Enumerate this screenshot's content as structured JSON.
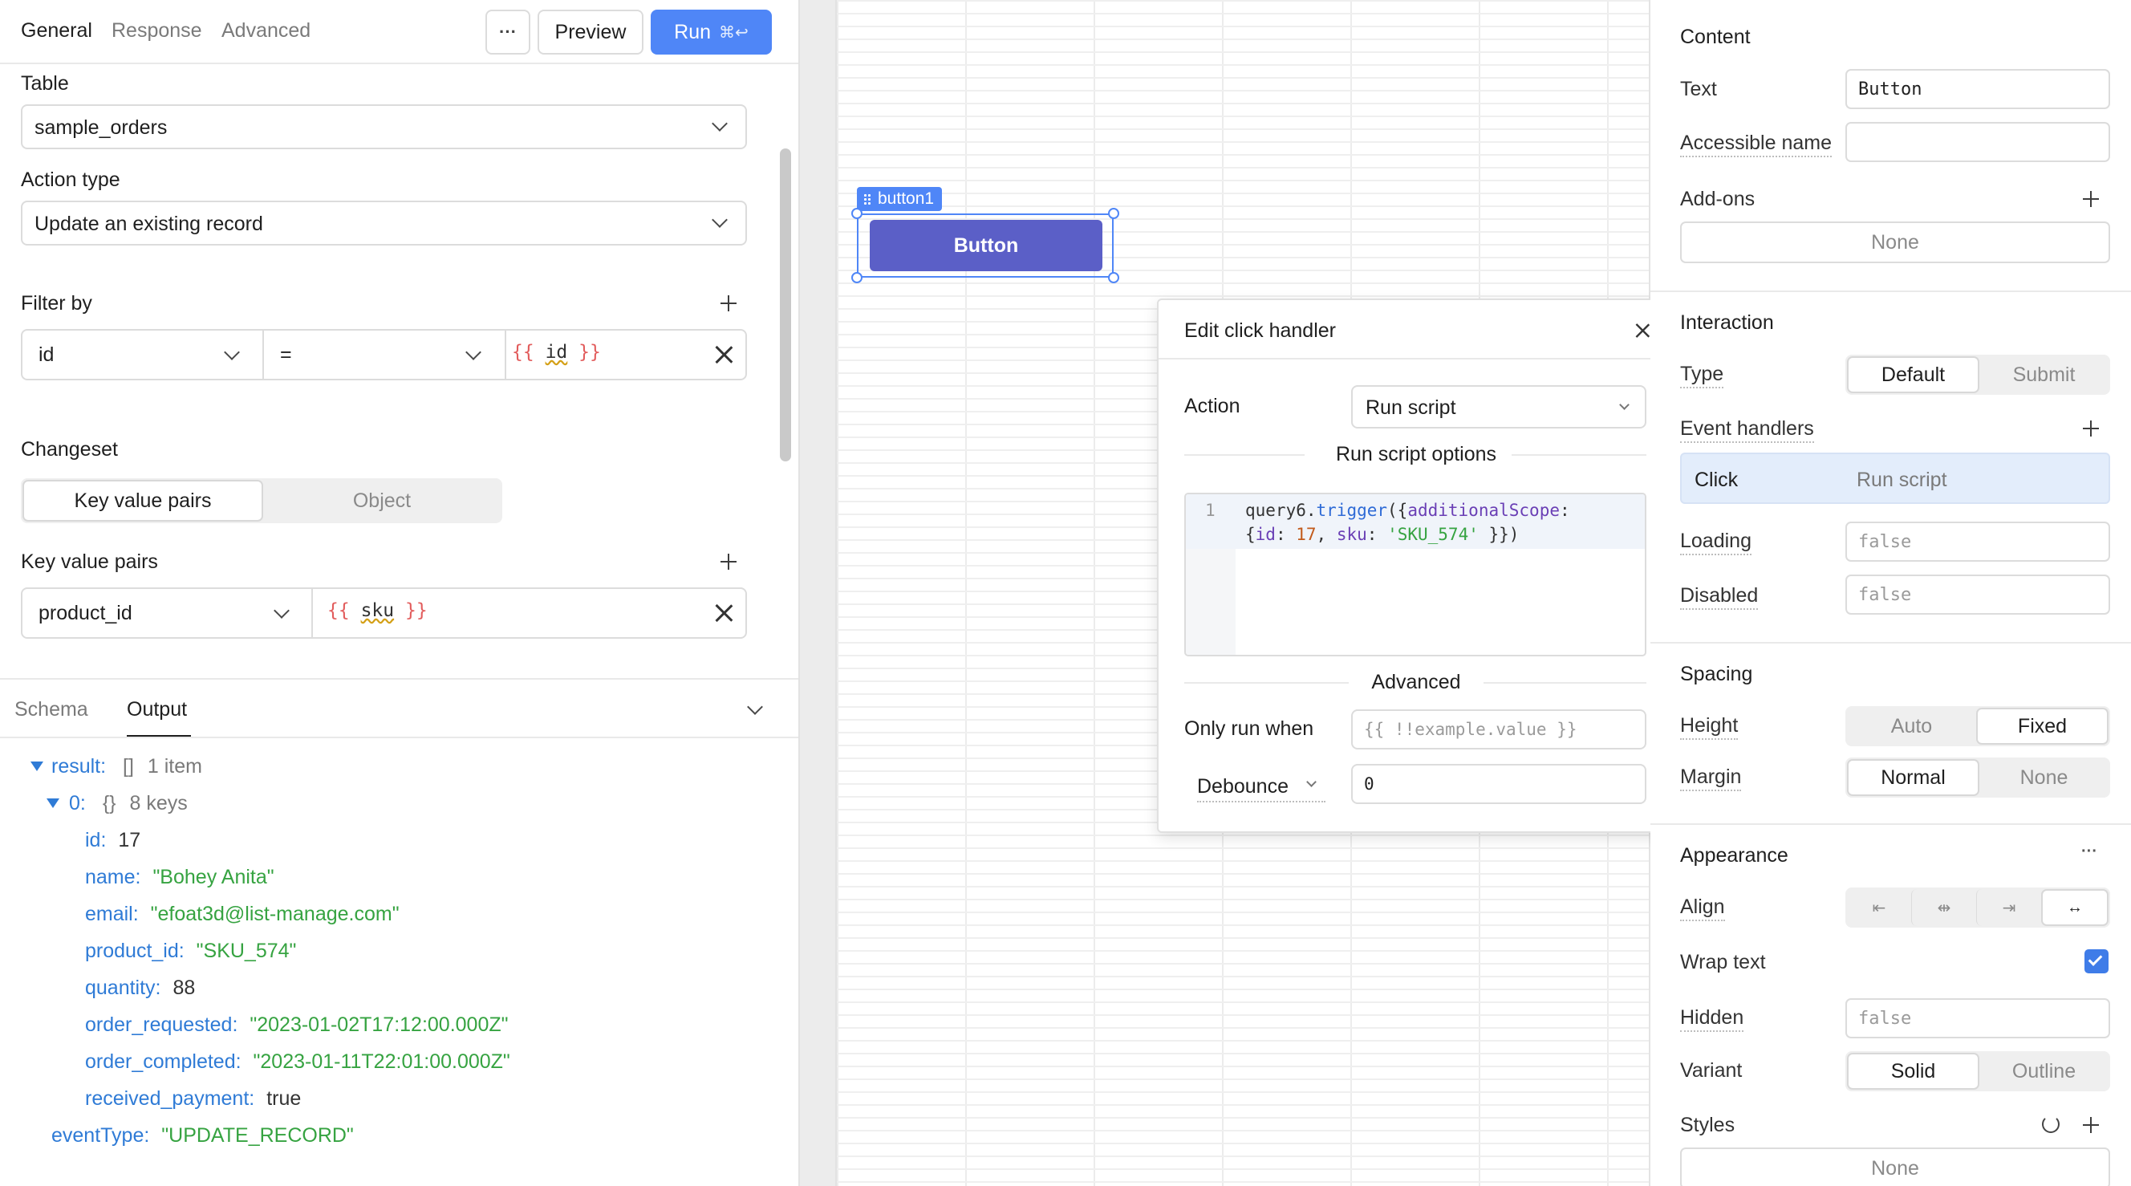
{
  "left_panel": {
    "tabs": [
      "General",
      "Response",
      "Advanced"
    ],
    "more_label": "···",
    "preview_label": "Preview",
    "run_label": "Run",
    "run_shortcut": "⌘↩",
    "table_label": "Table",
    "table_value": "sample_orders",
    "action_type_label": "Action type",
    "action_type_value": "Update an existing record",
    "filter_by_label": "Filter by",
    "filter": {
      "column": "id",
      "operator": "=",
      "value_open": "{{",
      "value_var": "id",
      "value_close": "}}"
    },
    "changeset_label": "Changeset",
    "changeset_options": [
      "Key value pairs",
      "Object"
    ],
    "kv_label": "Key value pairs",
    "kv_row": {
      "key": "product_id",
      "value_open": "{{",
      "value_var": "sku",
      "value_close": "}}"
    }
  },
  "output_panel": {
    "tabs": [
      "Schema",
      "Output"
    ],
    "result_key": "result:",
    "result_type": "[]",
    "result_count": "1 item",
    "item_key": "0:",
    "item_type": "{}",
    "item_count": "8 keys",
    "fields": [
      {
        "key": "id:",
        "value": "17",
        "kind": "num"
      },
      {
        "key": "name:",
        "value": "\"Bohey Anita\"",
        "kind": "str"
      },
      {
        "key": "email:",
        "value": "\"efoat3d@list-manage.com\"",
        "kind": "str"
      },
      {
        "key": "product_id:",
        "value": "\"SKU_574\"",
        "kind": "str"
      },
      {
        "key": "quantity:",
        "value": "88",
        "kind": "num"
      },
      {
        "key": "order_requested:",
        "value": "\"2023-01-02T17:12:00.000Z\"",
        "kind": "str"
      },
      {
        "key": "order_completed:",
        "value": "\"2023-01-11T22:01:00.000Z\"",
        "kind": "str"
      },
      {
        "key": "received_payment:",
        "value": "true",
        "kind": "num"
      }
    ],
    "event_key": "eventType:",
    "event_value": "\"UPDATE_RECORD\""
  },
  "canvas": {
    "component_tag": "button1",
    "button_label": "Button"
  },
  "click_handler": {
    "title": "Edit click handler",
    "action_label": "Action",
    "action_value": "Run script",
    "options_label": "Run script options",
    "line_number": "1",
    "code_line1": {
      "obj": "query6",
      "dot": ".",
      "fn": "trigger",
      "open": "({",
      "prop": "additionalScope",
      "colon": ":"
    },
    "code_line2": {
      "open": "{",
      "k1": "id",
      "c1": ": ",
      "v1": "17",
      "sep": ", ",
      "k2": "sku",
      "c2": ": ",
      "v2": "'SKU_574'",
      "close": " }})"
    },
    "advanced_label": "Advanced",
    "only_run_label": "Only run when",
    "only_run_placeholder": "{{ !!example.value }}",
    "debounce_label": "Debounce",
    "debounce_value": "0"
  },
  "right_panel": {
    "content_title": "Content",
    "text_label": "Text",
    "text_value": "Button",
    "accessible_label": "Accessible name",
    "addons_label": "Add-ons",
    "addons_value": "None",
    "interaction_title": "Interaction",
    "type_label": "Type",
    "type_options": [
      "Default",
      "Submit"
    ],
    "event_handlers_label": "Event handlers",
    "event_row": {
      "event": "Click",
      "action": "Run script"
    },
    "loading_label": "Loading",
    "loading_value": "false",
    "disabled_label": "Disabled",
    "disabled_value": "false",
    "spacing_title": "Spacing",
    "height_label": "Height",
    "height_options": [
      "Auto",
      "Fixed"
    ],
    "margin_label": "Margin",
    "margin_options": [
      "Normal",
      "None"
    ],
    "appearance_title": "Appearance",
    "appearance_more": "···",
    "align_label": "Align",
    "wrap_label": "Wrap text",
    "hidden_label": "Hidden",
    "hidden_value": "false",
    "variant_label": "Variant",
    "variant_options": [
      "Solid",
      "Outline"
    ],
    "styles_label": "Styles",
    "styles_value": "None"
  },
  "colors": {
    "accent": "#4f86f7",
    "button": "#5b5fc7",
    "selection": "#4f86f7",
    "string": "#36a341",
    "key": "#2f7bd6"
  }
}
